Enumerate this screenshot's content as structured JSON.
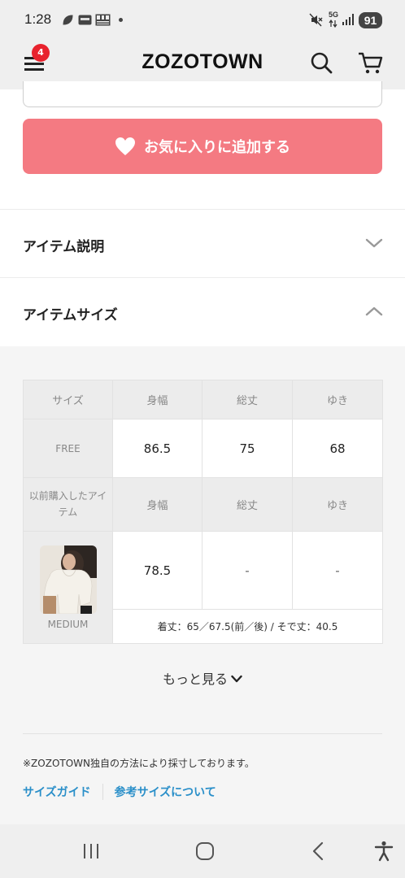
{
  "status_bar": {
    "time": "1:28",
    "network": "5G",
    "battery": "91",
    "icons": [
      "leaf-icon",
      "screen-icon",
      "qr-icon",
      "dot-icon",
      "mute-icon",
      "wifi-arrows-icon",
      "signal-icon",
      "battery-icon"
    ]
  },
  "header": {
    "menu_badge": "4",
    "logo": "ZOZOTOWN",
    "icons": [
      "menu-icon",
      "search-icon",
      "cart-icon"
    ]
  },
  "favorite_button": {
    "label": "お気に入りに追加する",
    "icon": "heart-icon"
  },
  "accordions": [
    {
      "label": "アイテム説明",
      "expanded": false
    },
    {
      "label": "アイテムサイズ",
      "expanded": true
    }
  ],
  "size_table": {
    "header_label": "サイズ",
    "columns": [
      "身幅",
      "総丈",
      "ゆき"
    ],
    "free_row": {
      "size": "FREE",
      "values": [
        "86.5",
        "75",
        "68"
      ]
    },
    "purchased_label": "以前購入したアイテム",
    "purchased_row": {
      "size": "MEDIUM",
      "values": [
        "78.5",
        "-",
        "-"
      ]
    },
    "purchased_note": "着丈：65／67.5(前／後) / そで丈：40.5"
  },
  "more_link": {
    "label": "もっと見る"
  },
  "footnote": "※ZOZOTOWN独自の方法により採寸しております。",
  "links": [
    "サイズガイド",
    "参考サイズについて"
  ],
  "colors": {
    "accent_pink": "#f47a82",
    "link_blue": "#2a8fc9",
    "badge_red": "#e8222d"
  },
  "nav_bar": {
    "icons": [
      "recent-apps-icon",
      "home-icon",
      "back-icon",
      "accessibility-icon"
    ]
  }
}
